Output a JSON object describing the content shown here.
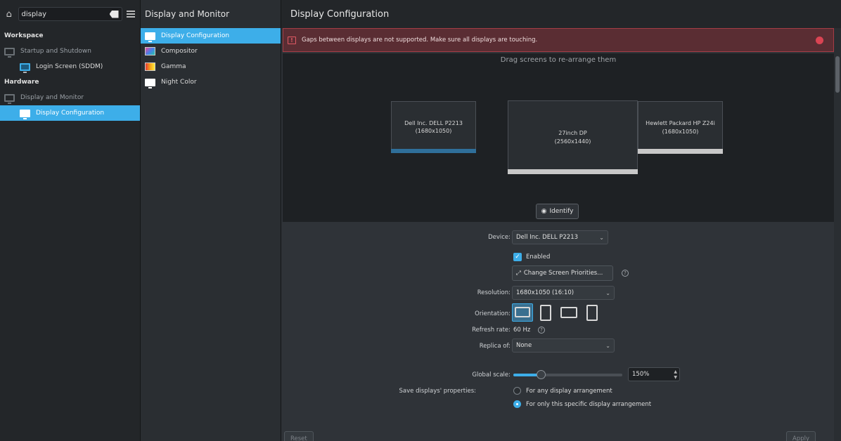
{
  "search": {
    "value": "display"
  },
  "sidebar": {
    "sections": [
      {
        "title": "Workspace"
      },
      {
        "title": "Hardware"
      }
    ],
    "items": [
      {
        "label": "Startup and Shutdown"
      },
      {
        "label": "Login Screen (SDDM)"
      },
      {
        "label": "Display and Monitor"
      },
      {
        "label": "Display Configuration"
      }
    ]
  },
  "midcol": {
    "title": "Display and Monitor",
    "items": [
      {
        "label": "Display Configuration"
      },
      {
        "label": "Compositor"
      },
      {
        "label": "Gamma"
      },
      {
        "label": "Night Color"
      }
    ]
  },
  "main": {
    "title": "Display Configuration",
    "error": "Gaps between displays are not supported. Make sure all displays are touching.",
    "drag_hint": "Drag screens to re-arrange them",
    "identify_label": "Identify",
    "accent_color": "#3daee9",
    "error_color": "#da4453"
  },
  "screens": [
    {
      "name": "Dell Inc. DELL P2213",
      "resolution": "(1680x1050)"
    },
    {
      "name": "27inch DP",
      "resolution": "(2560x1440)"
    },
    {
      "name": "Hewlett Packard HP Z24i",
      "resolution": "(1680x1050)"
    }
  ],
  "form": {
    "device_label": "Device:",
    "device_value": "Dell Inc. DELL P2213",
    "enabled_label": "Enabled",
    "priorities_button": "Change Screen Priorities...",
    "resolution_label": "Resolution:",
    "resolution_value": "1680x1050 (16:10)",
    "orientation_label": "Orientation:",
    "refresh_label": "Refresh rate:",
    "refresh_value": "60 Hz",
    "replica_label": "Replica of:",
    "replica_value": "None",
    "scale_label": "Global scale:",
    "scale_value": "150%",
    "scale_fraction": 0.25,
    "save_label": "Save displays' properties:",
    "save_option_any": "For any display arrangement",
    "save_option_specific": "For only this specific display arrangement",
    "save_selected": "specific"
  },
  "footer": {
    "left_button": "Reset",
    "right_button": "Apply"
  }
}
